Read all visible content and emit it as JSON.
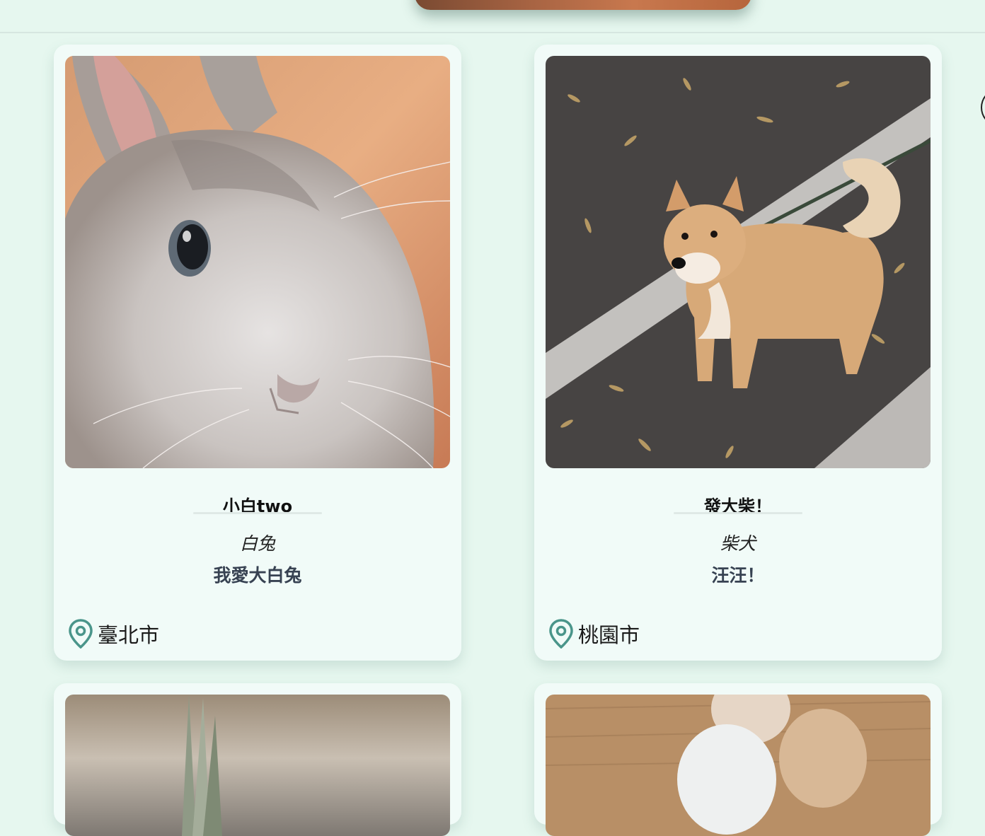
{
  "pets": [
    {
      "name": "小白two",
      "species": "白兔",
      "description": "我愛大白兔",
      "location": "臺北市",
      "photo": "rabbit"
    },
    {
      "name": "發大柴！",
      "species": "柴犬",
      "description": "汪汪！",
      "location": "桃園市",
      "photo": "shiba-dog"
    }
  ],
  "colors": {
    "background": "#e6f7ef",
    "card": "#f1fbf8",
    "pin": "#4a958a"
  },
  "icons": {
    "location": "map-pin-icon"
  }
}
